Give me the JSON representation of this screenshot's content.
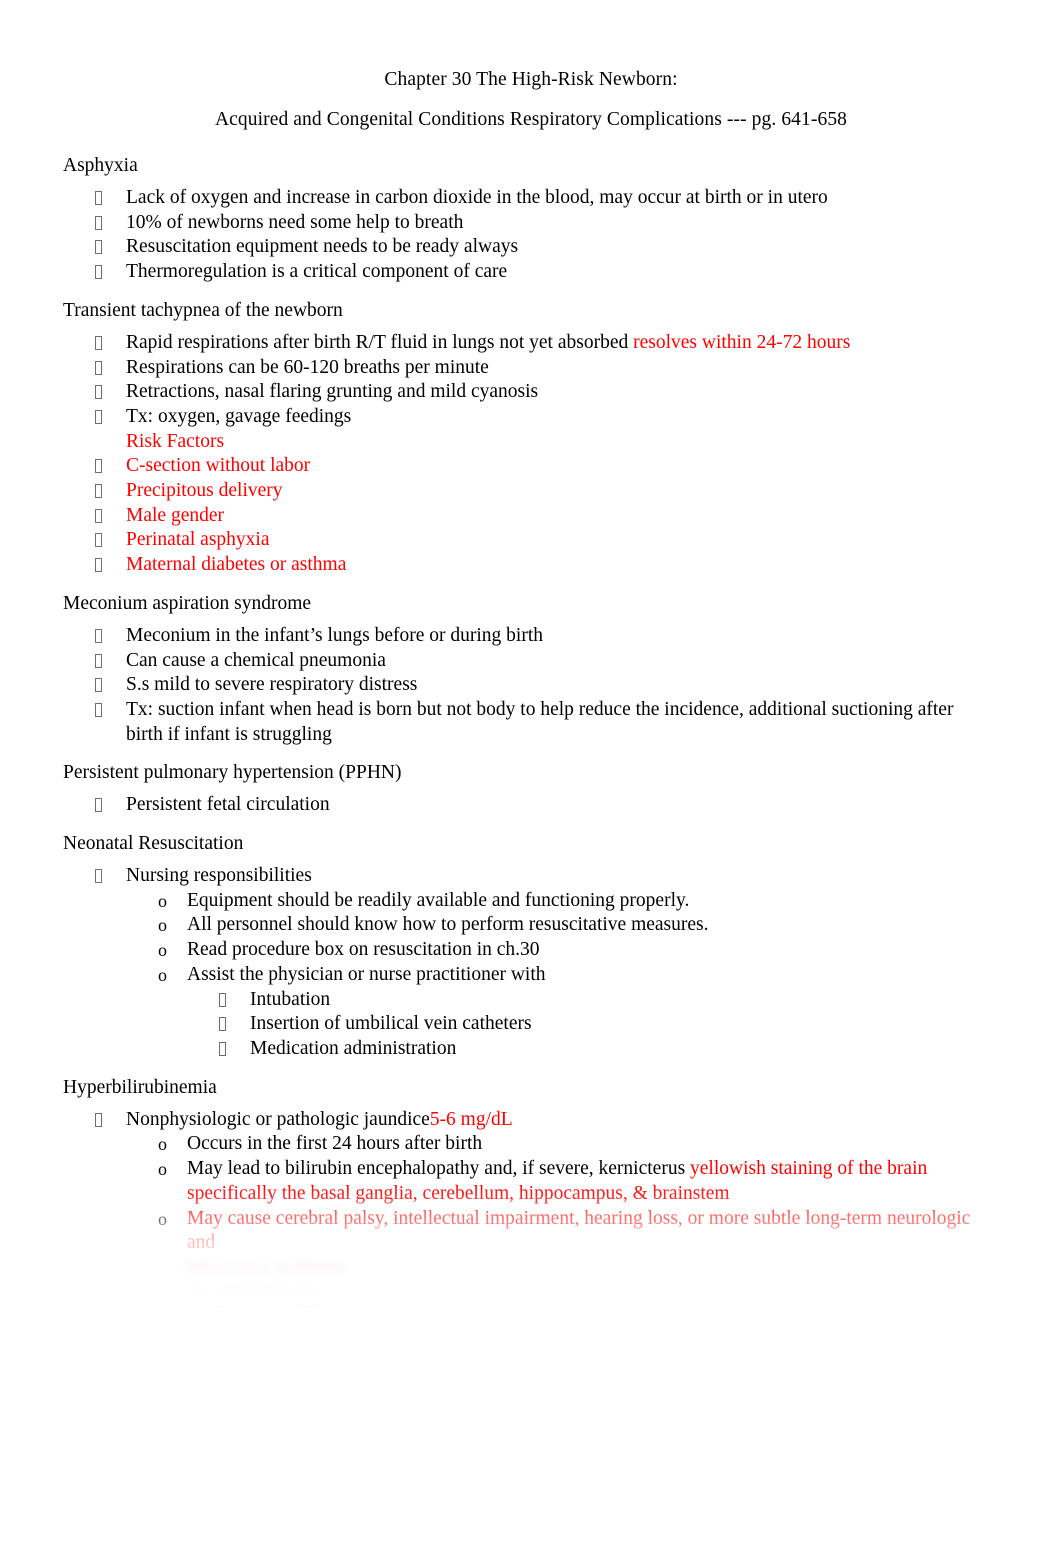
{
  "document": {
    "title_line_1": "Chapter 30 The High-Risk Newborn:",
    "title_line_2": "Acquired and Congenital Conditions Respiratory Complications --- pg. 641-658",
    "accent_color": "#ff0000",
    "body_color": "#000000"
  },
  "sections": [
    {
      "heading": "Asphyxia",
      "items": [
        {
          "level": 1,
          "text": "Lack of oxygen and increase in carbon dioxide in the blood, may occur at birth or in utero"
        },
        {
          "level": 1,
          "text": "10% of newborns need some help to breath"
        },
        {
          "level": 1,
          "text": "Resuscitation equipment needs to be ready always"
        },
        {
          "level": 1,
          "text": "Thermoregulation is a critical component of care"
        }
      ]
    },
    {
      "heading": "Transient tachypnea of the newborn",
      "items": [
        {
          "level": 1,
          "text": "Rapid respirations after birth R/T fluid in lungs not yet absorbed ",
          "red_tail": "resolves within 24-72 hours"
        },
        {
          "level": 1,
          "text": "Respirations can be 60-120 breaths per minute"
        },
        {
          "level": 1,
          "text": "Retractions, nasal flaring grunting and mild cyanosis"
        },
        {
          "level": 1,
          "text": "Tx: oxygen, gavage feedings",
          "continuation_red": "Risk Factors"
        },
        {
          "level": 1,
          "text": "C-section without labor",
          "color": "red"
        },
        {
          "level": 1,
          "text": "Precipitous delivery",
          "color": "red"
        },
        {
          "level": 1,
          "text": "Male gender",
          "color": "red"
        },
        {
          "level": 1,
          "text": "Perinatal asphyxia",
          "color": "red"
        },
        {
          "level": 1,
          "text": "Maternal diabetes or asthma",
          "color": "red"
        }
      ]
    },
    {
      "heading": "Meconium aspiration syndrome",
      "items": [
        {
          "level": 1,
          "text": "Meconium in the infant’s lungs before or during birth"
        },
        {
          "level": 1,
          "text": "Can cause a chemical pneumonia"
        },
        {
          "level": 1,
          "text": "S.s mild to severe respiratory distress"
        },
        {
          "level": 1,
          "text": "Tx: suction infant when head is born but not body to help reduce the incidence, additional suctioning after birth if infant is struggling"
        }
      ]
    },
    {
      "heading": "Persistent pulmonary hypertension (PPHN)",
      "items": [
        {
          "level": 1,
          "text": "Persistent fetal circulation"
        }
      ]
    },
    {
      "heading": "Neonatal Resuscitation",
      "items": [
        {
          "level": 1,
          "text": "Nursing responsibilities"
        },
        {
          "level": 2,
          "text": "Equipment should be readily available and functioning properly."
        },
        {
          "level": 2,
          "text": "All personnel should know how to perform resuscitative measures."
        },
        {
          "level": 2,
          "text": "Read procedure box on resuscitation in ch.30"
        },
        {
          "level": 2,
          "text": "Assist the physician or nurse practitioner with"
        },
        {
          "level": 3,
          "text": "Intubation"
        },
        {
          "level": 3,
          "text": "Insertion of umbilical vein catheters"
        },
        {
          "level": 3,
          "text": "Medication administration"
        }
      ]
    },
    {
      "heading": "Hyperbilirubinemia",
      "items": [
        {
          "level": 1,
          "text": "Nonphysiologic or pathologic jaundice",
          "red_tail": "5-6 mg/dL"
        },
        {
          "level": 2,
          "text": "Occurs in the first 24 hours after birth"
        },
        {
          "level": 2,
          "text": "May lead to bilirubin encephalopathy and, if severe, kernicterus  ",
          "red_tail": "yellowish staining of the brain specifically the basal ganglia, cerebellum, hippocampus, & brainstem"
        },
        {
          "level": 2,
          "text": "May cause cerebral palsy, intellectual impairment, hearing loss, or more subtle long-term neurologic and",
          "color": "red"
        }
      ]
    }
  ],
  "faded_tail": {
    "note": "Page bottom fades out; text is blurred and illegible.",
    "line_1_red": "behavioral problems",
    "line_2": "Tx: phototherapy"
  }
}
